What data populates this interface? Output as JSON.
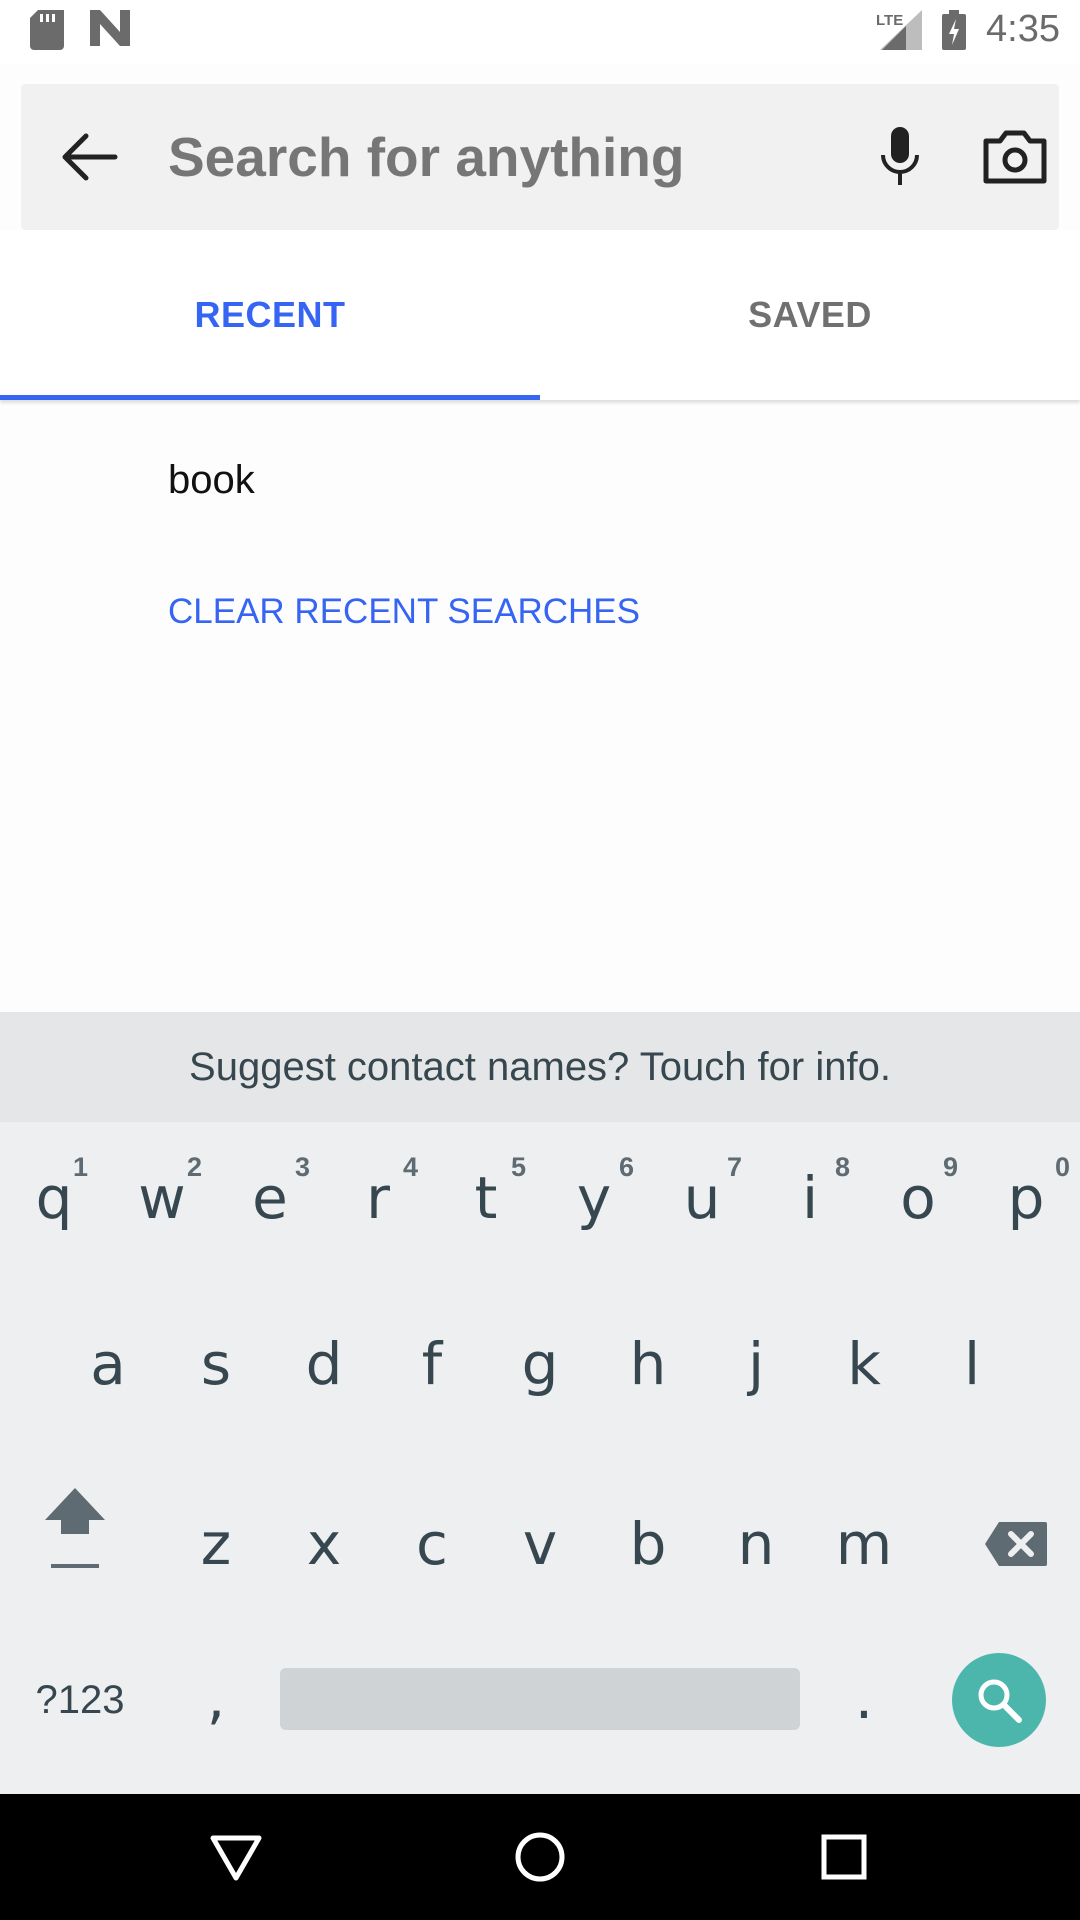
{
  "status_bar": {
    "time": "4:35",
    "network_label": "LTE",
    "icons": [
      "sd-card-icon",
      "n-logo-icon",
      "signal-icon",
      "battery-charging-icon"
    ]
  },
  "search": {
    "placeholder": "Search for anything",
    "value": "",
    "icons": [
      "back-arrow-icon",
      "microphone-icon",
      "camera-icon"
    ]
  },
  "tabs": [
    {
      "label": "RECENT",
      "selected": true
    },
    {
      "label": "SAVED",
      "selected": false
    }
  ],
  "recent_searches": [
    "book"
  ],
  "clear_label": "CLEAR RECENT SEARCHES",
  "colors": {
    "accent": "#3665f3",
    "keyboard_bg": "#edeff1",
    "search_key": "#4db6ac"
  },
  "keyboard": {
    "suggestion": "Suggest contact names? Touch for info.",
    "row1": [
      {
        "key": "q",
        "num": "1"
      },
      {
        "key": "w",
        "num": "2"
      },
      {
        "key": "e",
        "num": "3"
      },
      {
        "key": "r",
        "num": "4"
      },
      {
        "key": "t",
        "num": "5"
      },
      {
        "key": "y",
        "num": "6"
      },
      {
        "key": "u",
        "num": "7"
      },
      {
        "key": "i",
        "num": "8"
      },
      {
        "key": "o",
        "num": "9"
      },
      {
        "key": "p",
        "num": "0"
      }
    ],
    "row2": [
      "a",
      "s",
      "d",
      "f",
      "g",
      "h",
      "j",
      "k",
      "l"
    ],
    "row3": [
      "z",
      "x",
      "c",
      "v",
      "b",
      "n",
      "m"
    ],
    "symbols_label": "?123",
    "comma": ",",
    "period": "."
  },
  "nav_bar": {
    "icons": [
      "back-triangle-icon",
      "home-circle-icon",
      "recents-square-icon"
    ]
  }
}
